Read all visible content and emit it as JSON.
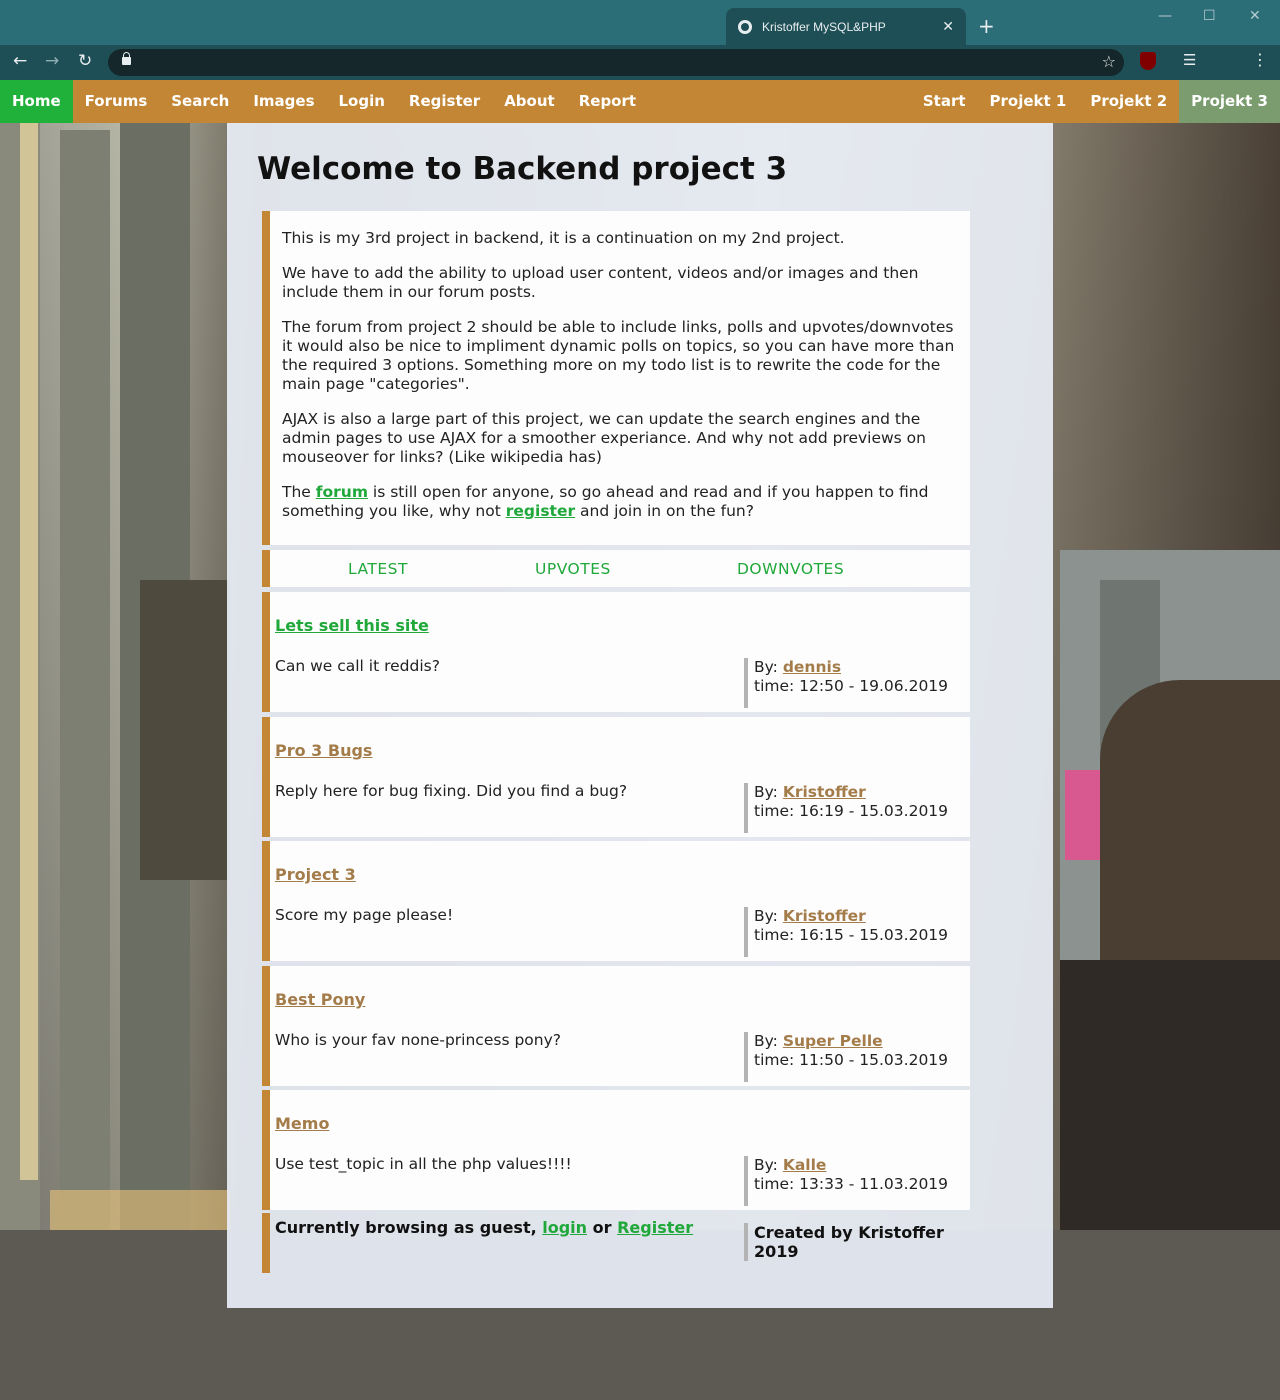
{
  "browser": {
    "tab_title": "Kristoffer MySQL&PHP",
    "tab_close": "✕",
    "new_tab": "+",
    "back": "←",
    "forward": "→",
    "reload": "↻",
    "star": "☆",
    "menu": "⋮",
    "media": "☰",
    "minimize": "—",
    "maximize": "☐",
    "close": "✕"
  },
  "nav": {
    "left": [
      "Home",
      "Forums",
      "Search",
      "Images",
      "Login",
      "Register",
      "About",
      "Report"
    ],
    "right": [
      "Start",
      "Projekt 1",
      "Projekt 2",
      "Projekt 3"
    ],
    "active_left": "Home",
    "active_right": "Projekt 3"
  },
  "page": {
    "title": "Welcome to Backend project 3",
    "intro": {
      "p1": "This is my 3rd project in backend, it is a continuation on my 2nd project.",
      "p2": "We have to add the ability to upload user content, videos and/or images and then include them in our forum posts.",
      "p3": "The forum from project 2 should be able to include links, polls and upvotes/downvotes it would also be nice to impliment dynamic polls on topics, so you can have more than the required 3 options. Something more on my todo list is to rewrite the code for the main page \"categories\".",
      "p4": "AJAX is also a large part of this project, we can update the search engines and the admin pages to use AJAX for a smoother experiance. And why not add previews on mouseover for links? (Like wikipedia has)",
      "p5_a": "The ",
      "p5_link1": "forum",
      "p5_b": " is still open for anyone, so go ahead and read and if you happen to find something you like, why not ",
      "p5_link2": "register",
      "p5_c": " and join in on the fun?"
    },
    "sort": [
      "LATEST",
      "UPVOTES",
      "DOWNVOTES"
    ],
    "posts": [
      {
        "title": "Lets sell this site",
        "body": "Can we call it reddis?",
        "by_label": "By: ",
        "author": "dennis",
        "time": "time: 12:50 - 19.06.2019"
      },
      {
        "title": "Pro 3 Bugs",
        "body": "Reply here for bug fixing. Did you find a bug?",
        "by_label": "By: ",
        "author": "Kristoffer",
        "time": "time: 16:19 - 15.03.2019"
      },
      {
        "title": "Project 3",
        "body": "Score my page please!",
        "by_label": "By: ",
        "author": "Kristoffer",
        "time": "time: 16:15 - 15.03.2019"
      },
      {
        "title": "Best Pony",
        "body": "Who is your fav none-princess pony?",
        "by_label": "By: ",
        "author": "Super Pelle",
        "time": "time: 11:50 - 15.03.2019"
      },
      {
        "title": "Memo",
        "body": "Use test_topic in all the php values!!!!",
        "by_label": "By: ",
        "author": "Kalle",
        "time": "time: 13:33 - 11.03.2019"
      }
    ],
    "footer": {
      "guest_a": "Currently browsing as guest, ",
      "login": "login",
      "or": " or ",
      "register": "Register",
      "credit": "Created by Kristoffer 2019"
    }
  },
  "colors": {
    "nav_bg": "#c38634",
    "home_bg": "#20b13a",
    "projekt3_bg": "#7b9c6e",
    "link_green": "#20a83a",
    "link_brown": "#a37c4a"
  }
}
